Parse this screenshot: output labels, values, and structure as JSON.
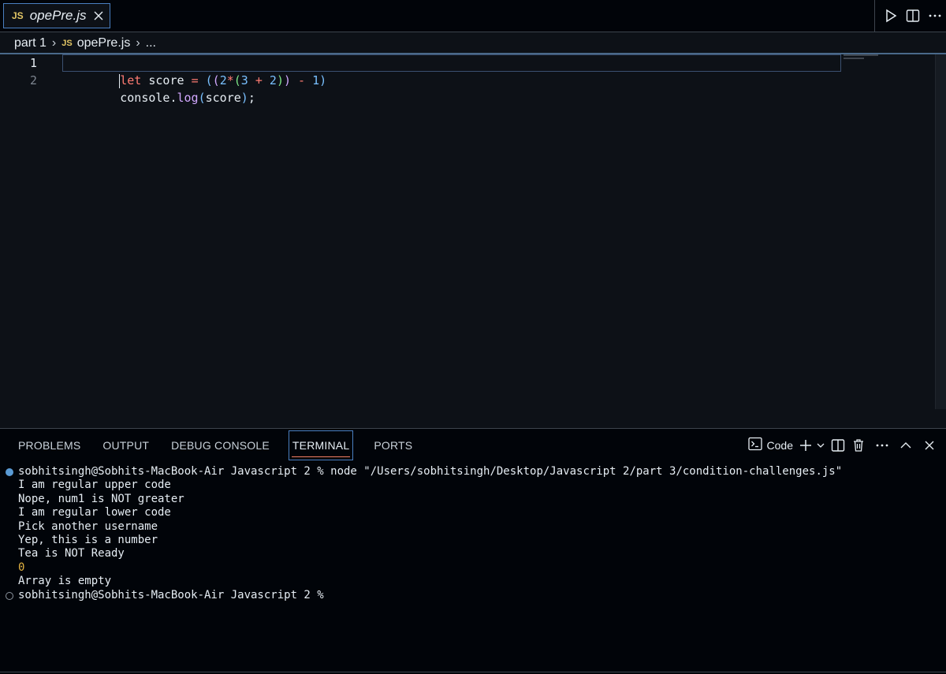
{
  "tab": {
    "badge": "JS",
    "filename": "opePre.js"
  },
  "title_actions": [
    {
      "name": "run-icon"
    },
    {
      "name": "split-editor-icon"
    },
    {
      "name": "more-actions-icon"
    }
  ],
  "breadcrumb": {
    "folder": "part 1",
    "badge": "JS",
    "file": "opePre.js",
    "more": "..."
  },
  "editor": {
    "line_numbers": [
      "1",
      "2"
    ],
    "lines": [
      "let score = ((2*(3 + 2)) - 1)",
      "console.log(score);"
    ]
  },
  "panel": {
    "tabs": [
      {
        "label": "PROBLEMS"
      },
      {
        "label": "OUTPUT"
      },
      {
        "label": "DEBUG CONSOLE"
      },
      {
        "label": "TERMINAL",
        "active": true
      },
      {
        "label": "PORTS"
      }
    ],
    "terminal_profile": "Code",
    "actions": [
      "new-terminal-icon",
      "dropdown-icon",
      "split-terminal-icon",
      "trash-icon",
      "more-actions-icon",
      "maximize-panel-icon",
      "close-panel-icon"
    ]
  },
  "terminal": {
    "lines": [
      {
        "text": "sobhitsingh@Sobhits-MacBook-Air Javascript 2 % node \"/Users/sobhitsingh/Desktop/Javascript 2/part 3/condition-challenges.js\"",
        "marker": "filled"
      },
      {
        "text": "I am regular upper code"
      },
      {
        "text": "Nope, num1 is NOT greater"
      },
      {
        "text": "I am regular lower code"
      },
      {
        "text": "Pick another username"
      },
      {
        "text": "Yep, this is a number"
      },
      {
        "text": "Tea is NOT Ready"
      },
      {
        "text": "0",
        "color": "yellow"
      },
      {
        "text": "Array is empty"
      },
      {
        "text": "sobhitsingh@Sobhits-MacBook-Air Javascript 2 % ",
        "marker": "hollow"
      }
    ]
  },
  "colors": {
    "background": "#0d1117",
    "accent": "#4a7fc1",
    "js_badge": "#e3c665",
    "active_tab_underline": "#f78166"
  }
}
